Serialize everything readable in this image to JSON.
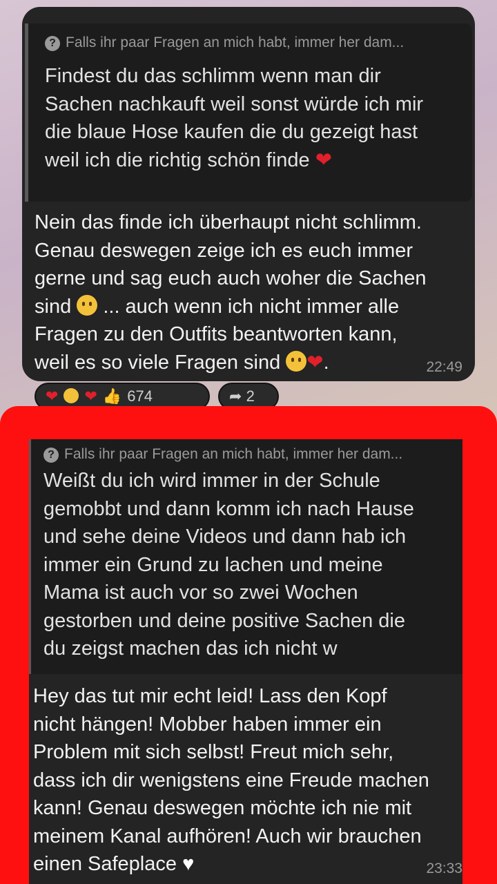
{
  "message1": {
    "quote_header": "Falls ihr paar Fragen an mich habt, immer her dam...",
    "quote_lines": [
      "Findest du das schlimm wenn man dir",
      "Sachen nachkauft weil sonst würde ich mir",
      "die blaue Hose kaufen die du gezeigt hast",
      "weil ich die richtig schön finde"
    ],
    "reply_lines": [
      "Nein das finde ich überhaupt nicht schlimm.",
      "Genau deswegen zeige ich es euch immer",
      "gerne und sag euch auch woher die Sachen",
      "sind",
      "... auch wenn ich nicht immer alle",
      "Fragen zu den Outfits beantworten kann,",
      "weil es so viele Fragen sind",
      "."
    ],
    "time": "22:49",
    "reaction_count": "674",
    "forward_count": "2"
  },
  "message2": {
    "quote_header": "Falls ihr paar Fragen an mich habt, immer her dam...",
    "quote_lines": [
      "Weißt du ich  wird immer in der Schule",
      "gemobbt und dann komm ich nach Hause",
      "und sehe deine Videos und dann hab ich",
      "immer ein Grund zu lachen und meine",
      "Mama ist auch vor so zwei Wochen",
      "gestorben und deine positive Sachen die",
      "du zeigst machen das ich nicht w"
    ],
    "reply_lines": [
      "Hey das tut mir echt leid! Lass den Kopf",
      "nicht hängen! Mobber haben immer ein",
      "Problem mit sich selbst! Freut mich sehr,",
      "dass ich dir wenigstens eine Freude machen",
      "kann! Genau deswegen möchte ich nie mit",
      "meinem Kanal aufhören! Auch wir brauchen",
      "einen Safeplace"
    ],
    "time": "23:33"
  },
  "icons": {
    "quote": "question-circle-icon",
    "heart": "red-heart-emoji",
    "hug": "hugging-face-emoji",
    "peek": "face-peeking-emoji",
    "smile": "smiling-face-emoji",
    "thumb": "thumbs-up-emoji",
    "forward": "forward-arrow-icon",
    "white_heart": "white-heart-emoji"
  },
  "colors": {
    "bubble": "#242424",
    "quote_bg": "#1c1c1c",
    "highlight_frame": "#ff1010",
    "heart": "#e0202a"
  }
}
